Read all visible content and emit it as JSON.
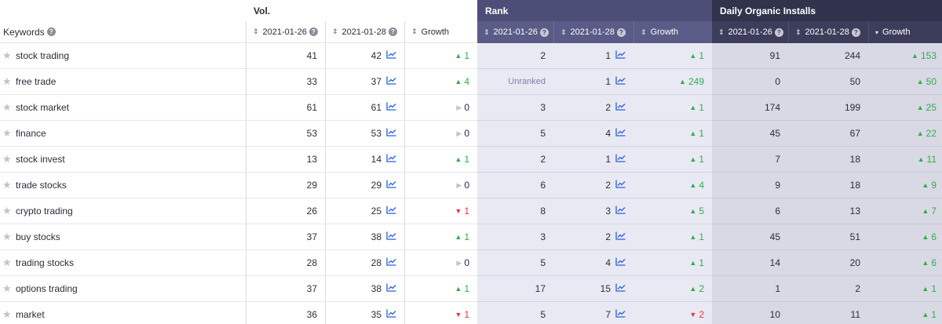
{
  "groups": {
    "vol": "Vol.",
    "rank": "Rank",
    "doi": "Daily Organic Installs"
  },
  "headers": {
    "keywords": "Keywords",
    "date1": "2021-01-26",
    "date2": "2021-01-28",
    "growth": "Growth"
  },
  "colors": {
    "up": "#2fae4a",
    "down": "#e5383b",
    "rank_header": "#4d4e78",
    "installs_header": "#31334d"
  },
  "rows": [
    {
      "keyword": "stock trading",
      "vol1": "41",
      "vol2": "42",
      "volG": "1",
      "volDir": "up",
      "rank1": "2",
      "rank2": "1",
      "rankG": "1",
      "rankDir": "up",
      "ins1": "91",
      "ins2": "244",
      "insG": "153",
      "insDir": "up"
    },
    {
      "keyword": "free trade",
      "vol1": "33",
      "vol2": "37",
      "volG": "4",
      "volDir": "up",
      "rank1": "Unranked",
      "rank2": "1",
      "rankG": "249",
      "rankDir": "up",
      "ins1": "0",
      "ins2": "50",
      "insG": "50",
      "insDir": "up"
    },
    {
      "keyword": "stock market",
      "vol1": "61",
      "vol2": "61",
      "volG": "0",
      "volDir": "flat",
      "rank1": "3",
      "rank2": "2",
      "rankG": "1",
      "rankDir": "up",
      "ins1": "174",
      "ins2": "199",
      "insG": "25",
      "insDir": "up"
    },
    {
      "keyword": "finance",
      "vol1": "53",
      "vol2": "53",
      "volG": "0",
      "volDir": "flat",
      "rank1": "5",
      "rank2": "4",
      "rankG": "1",
      "rankDir": "up",
      "ins1": "45",
      "ins2": "67",
      "insG": "22",
      "insDir": "up"
    },
    {
      "keyword": "stock invest",
      "vol1": "13",
      "vol2": "14",
      "volG": "1",
      "volDir": "up",
      "rank1": "2",
      "rank2": "1",
      "rankG": "1",
      "rankDir": "up",
      "ins1": "7",
      "ins2": "18",
      "insG": "11",
      "insDir": "up"
    },
    {
      "keyword": "trade stocks",
      "vol1": "29",
      "vol2": "29",
      "volG": "0",
      "volDir": "flat",
      "rank1": "6",
      "rank2": "2",
      "rankG": "4",
      "rankDir": "up",
      "ins1": "9",
      "ins2": "18",
      "insG": "9",
      "insDir": "up"
    },
    {
      "keyword": "crypto trading",
      "vol1": "26",
      "vol2": "25",
      "volG": "1",
      "volDir": "down",
      "rank1": "8",
      "rank2": "3",
      "rankG": "5",
      "rankDir": "up",
      "ins1": "6",
      "ins2": "13",
      "insG": "7",
      "insDir": "up"
    },
    {
      "keyword": "buy stocks",
      "vol1": "37",
      "vol2": "38",
      "volG": "1",
      "volDir": "up",
      "rank1": "3",
      "rank2": "2",
      "rankG": "1",
      "rankDir": "up",
      "ins1": "45",
      "ins2": "51",
      "insG": "6",
      "insDir": "up"
    },
    {
      "keyword": "trading stocks",
      "vol1": "28",
      "vol2": "28",
      "volG": "0",
      "volDir": "flat",
      "rank1": "5",
      "rank2": "4",
      "rankG": "1",
      "rankDir": "up",
      "ins1": "14",
      "ins2": "20",
      "insG": "6",
      "insDir": "up"
    },
    {
      "keyword": "options trading",
      "vol1": "37",
      "vol2": "38",
      "volG": "1",
      "volDir": "up",
      "rank1": "17",
      "rank2": "15",
      "rankG": "2",
      "rankDir": "up",
      "ins1": "1",
      "ins2": "2",
      "insG": "1",
      "insDir": "up"
    },
    {
      "keyword": "market",
      "vol1": "36",
      "vol2": "35",
      "volG": "1",
      "volDir": "down",
      "rank1": "5",
      "rank2": "7",
      "rankG": "2",
      "rankDir": "down",
      "ins1": "10",
      "ins2": "11",
      "insG": "1",
      "insDir": "up"
    }
  ]
}
